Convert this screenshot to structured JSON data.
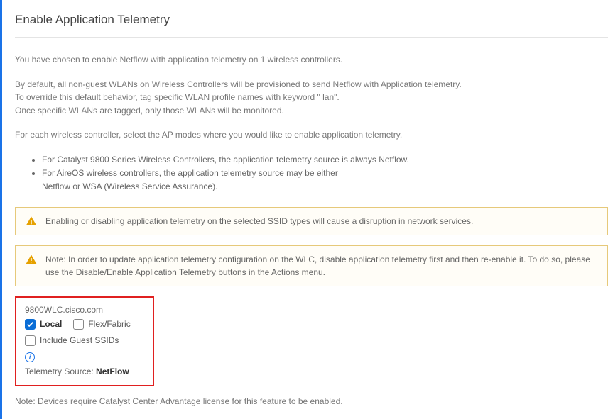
{
  "title": "Enable Application Telemetry",
  "intro": {
    "line1": "You have chosen to enable Netflow with application telemetry on 1 wireless controllers.",
    "line2a": "By default, all non-guest WLANs on Wireless Controllers will be provisioned to send Netflow with Application telemetry.",
    "line2b": "To override this default behavior, tag specific WLAN profile names with keyword \" lan\".",
    "line2c": "Once specific WLANs are tagged, only those WLANs will be monitored.",
    "line3": "For each wireless controller, select the AP modes where you would like to enable application telemetry."
  },
  "bullets": {
    "b1": "For Catalyst 9800 Series Wireless Controllers, the application telemetry source is always Netflow.",
    "b2a": "For AireOS wireless controllers, the application telemetry source may be either",
    "b2b": "Netflow or WSA (Wireless Service Assurance)."
  },
  "alert1": "Enabling or disabling application telemetry on the selected SSID types will cause a disruption in network services.",
  "alert2": "Note: In order to update application telemetry configuration on the WLC, disable application telemetry first and then re-enable it. To do so, please use the Disable/Enable Application Telemetry buttons in the Actions menu.",
  "device": {
    "name": "9800WLC.cisco.com",
    "local_label": "Local",
    "local_checked": true,
    "flex_label": "Flex/Fabric",
    "flex_checked": false,
    "guest_label": "Include Guest SSIDs",
    "guest_checked": false,
    "source_label": "Telemetry Source: ",
    "source_value": "NetFlow"
  },
  "footer": "Note: Devices require Catalyst Center Advantage license for this feature to be enabled."
}
